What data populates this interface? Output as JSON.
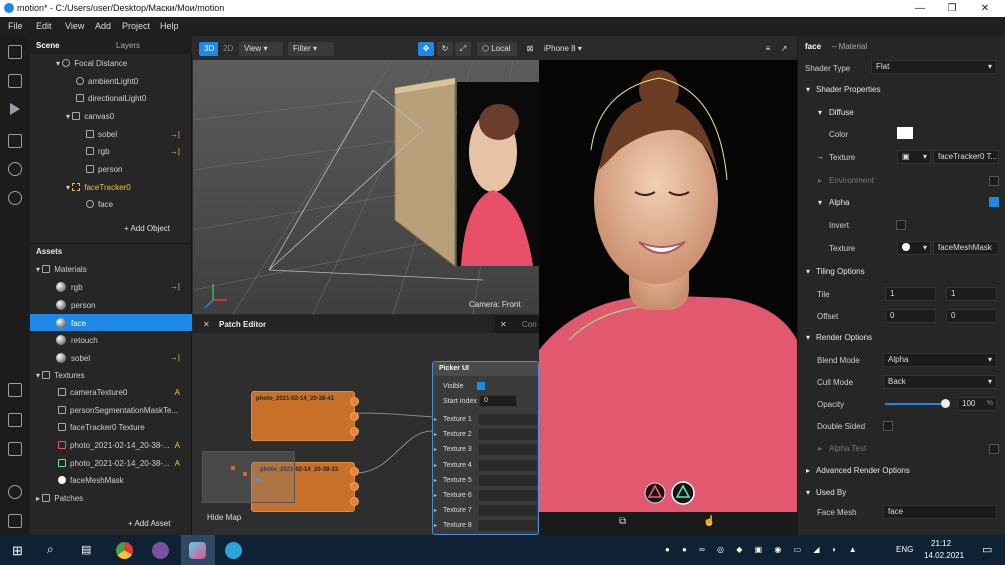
{
  "window": {
    "title": "motion* - C:/Users/user/Desktop/Маски/Мои/motion",
    "minimize": "—",
    "maximize": "❐",
    "close": "✕"
  },
  "menu": [
    "File",
    "Edit",
    "View",
    "Add",
    "Project",
    "Help"
  ],
  "scene_panel": {
    "tabs": [
      "Scene",
      "Layers"
    ],
    "tree": [
      {
        "label": "Focal Distance",
        "icon": "focal-distance-icon"
      },
      {
        "label": "ambientLight0",
        "icon": "light-icon"
      },
      {
        "label": "directionalLight0",
        "icon": "directional-light-icon"
      },
      {
        "label": "canvas0",
        "icon": "canvas-icon"
      },
      {
        "label": "sobel",
        "icon": "rectangle-icon",
        "flag": "→|"
      },
      {
        "label": "rgb",
        "icon": "rectangle-icon",
        "flag": "→|"
      },
      {
        "label": "person",
        "icon": "rectangle-icon"
      },
      {
        "label": "faceTracker0",
        "icon": "face-tracker-icon"
      },
      {
        "label": "face",
        "icon": "face-mesh-icon"
      }
    ],
    "add_object": "+ Add Object",
    "assets_title": "Assets",
    "materials_title": "Materials",
    "materials": [
      {
        "label": "rgb",
        "flag": "→|"
      },
      {
        "label": "person"
      },
      {
        "label": "face",
        "selected": true
      },
      {
        "label": "retouch"
      },
      {
        "label": "sobel",
        "flag": "→|"
      }
    ],
    "textures_title": "Textures",
    "textures": [
      {
        "label": "cameraTexture0",
        "flag": "A"
      },
      {
        "label": "personSegmentationMaskTe..."
      },
      {
        "label": "faceTracker0 Texture"
      },
      {
        "label": "photo_2021-02-14_20-38-...",
        "flag": "A"
      },
      {
        "label": "photo_2021-02-14_20-38-...",
        "flag": "A"
      },
      {
        "label": "faceMeshMask"
      }
    ],
    "patches_title": "Patches",
    "add_asset": "+ Add Asset"
  },
  "viewport_toolbar": {
    "mode_3d": "3D",
    "mode_2d": "2D",
    "view": "View",
    "filter": "Filter",
    "local": "Local",
    "device": "iPhone 8"
  },
  "viewport": {
    "camera_label": "Camera: Front"
  },
  "patch_editor": {
    "title": "Patch Editor",
    "tab2": "Con",
    "hide_map": "Hide Map",
    "node1": "photo_2021-02-14_20-38-41",
    "node2": "photo_2021-02-14_20-38-33",
    "picker": {
      "title": "Picker UI",
      "visible": "Visible",
      "start_index": "Start Index",
      "start_index_value": "0",
      "textures": [
        "Texture 1",
        "Texture 2",
        "Texture 3",
        "Texture 4",
        "Texture 5",
        "Texture 6",
        "Texture 7",
        "Texture 8"
      ]
    }
  },
  "inspector": {
    "object": "face",
    "type": "– Material",
    "shader_type_label": "Shader Type",
    "shader_type_value": "Flat",
    "shader_properties": "Shader Properties",
    "diffuse": "Diffuse",
    "color_label": "Color",
    "texture_label": "Texture",
    "diffuse_texture": "faceTracker0 T...",
    "environment": "Environment",
    "alpha": "Alpha",
    "invert": "Invert",
    "alpha_texture_label": "Texture",
    "alpha_texture": "faceMeshMask",
    "tiling_options": "Tiling Options",
    "tile_label": "Tile",
    "tile": [
      "1",
      "1"
    ],
    "offset_label": "Offset",
    "offset": [
      "0",
      "0"
    ],
    "render_options": "Render Options",
    "blend_mode_label": "Blend Mode",
    "blend_mode": "Alpha",
    "cull_mode_label": "Cull Mode",
    "cull_mode": "Back",
    "opacity_label": "Opacity",
    "opacity_value": "100",
    "opacity_unit": "%",
    "opacity_fraction": 1.0,
    "double_sided": "Double Sided",
    "alpha_test": "Alpha Test",
    "advanced_render": "Advanced Render Options",
    "used_by": "Used By",
    "face_mesh_label": "Face Mesh",
    "face_mesh_value": "face"
  },
  "taskbar": {
    "lang": "ENG",
    "time": "21:12",
    "date": "14.02.2021"
  },
  "colors": {
    "accent": "#1e88e5",
    "node": "#c8702a",
    "panel": "#262626"
  }
}
